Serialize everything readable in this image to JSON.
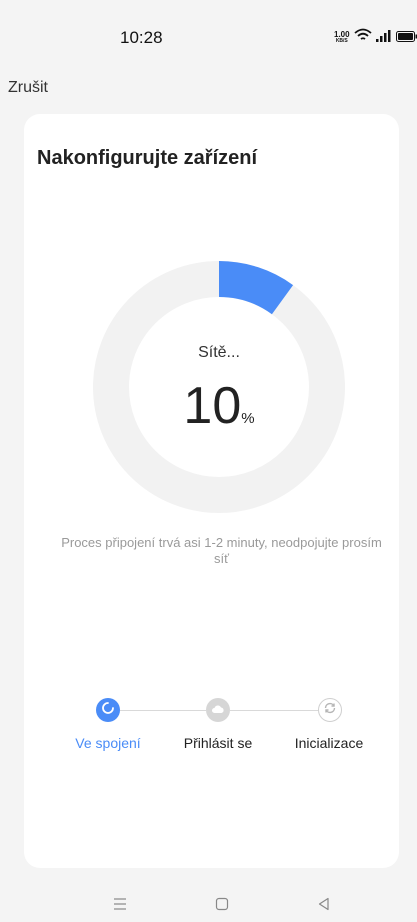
{
  "status_bar": {
    "time": "10:28",
    "net_speed_value": "1.00",
    "net_speed_unit": "KB/S",
    "icons": [
      "wifi-icon",
      "signal-icon",
      "battery-icon"
    ]
  },
  "header": {
    "cancel_label": "Zrušit"
  },
  "card": {
    "title": "Nakonfigurujte zařízení",
    "progress": {
      "status_label": "Sítě...",
      "value": "10",
      "unit": "%",
      "fraction": 0.1,
      "color": "#4a8cf7",
      "track_color": "#f2f2f2"
    },
    "hint": "Proces připojení trvá asi 1-2 minuty, neodpojujte prosím síť"
  },
  "steps": [
    {
      "label": "Ve spojení",
      "icon": "spinner-icon",
      "active": true
    },
    {
      "label": "Přihlásit se",
      "icon": "cloud-icon",
      "active": false
    },
    {
      "label": "Inicializace",
      "icon": "refresh-icon",
      "active": false
    }
  ],
  "nav_bar": {
    "icons": [
      "menu-icon",
      "home-icon",
      "back-icon"
    ]
  },
  "colors": {
    "accent": "#4a8cf7",
    "inactive": "#d6d6d6",
    "background": "#f4f4f4"
  }
}
